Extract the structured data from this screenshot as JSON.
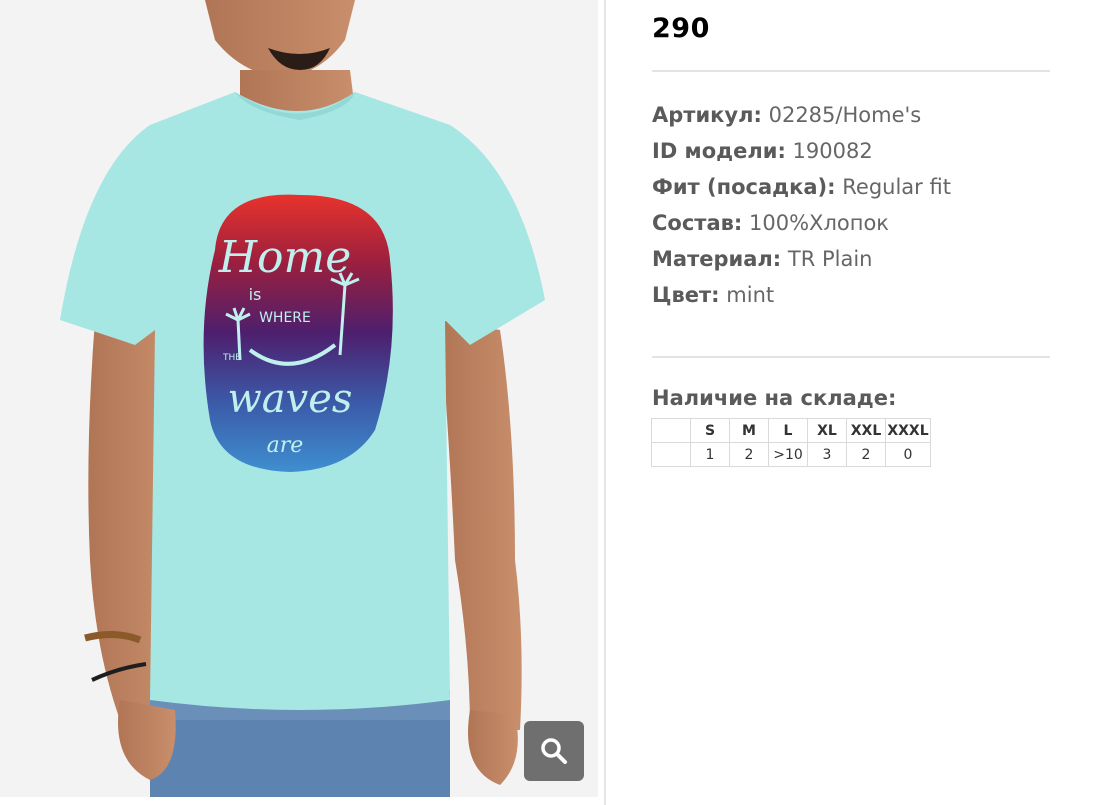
{
  "product": {
    "price": "290",
    "specs": [
      {
        "label": "Артикул:",
        "value": "02285/Home's"
      },
      {
        "label": "ID модели:",
        "value": "190082"
      },
      {
        "label": "Фит (посадка):",
        "value": "Regular fit"
      },
      {
        "label": "Состав:",
        "value": "100%Хлопок"
      },
      {
        "label": "Материал:",
        "value": "TR Plain"
      },
      {
        "label": "Цвет:",
        "value": "mint"
      }
    ]
  },
  "image": {
    "print_text": {
      "line1": "Home",
      "line2": "is",
      "line3": "WHERE",
      "line4": "THE",
      "line5": "waves",
      "line6": "are"
    },
    "zoom_icon": "search-icon"
  },
  "stock": {
    "title": "Наличие на складе:",
    "sizes": [
      "S",
      "M",
      "L",
      "XL",
      "XXL",
      "XXXL"
    ],
    "counts": [
      "1",
      "2",
      ">10",
      "3",
      "2",
      "0"
    ]
  },
  "colors": {
    "shirt": "#a6e6e3",
    "zoom_button": "#6f6f6f"
  }
}
